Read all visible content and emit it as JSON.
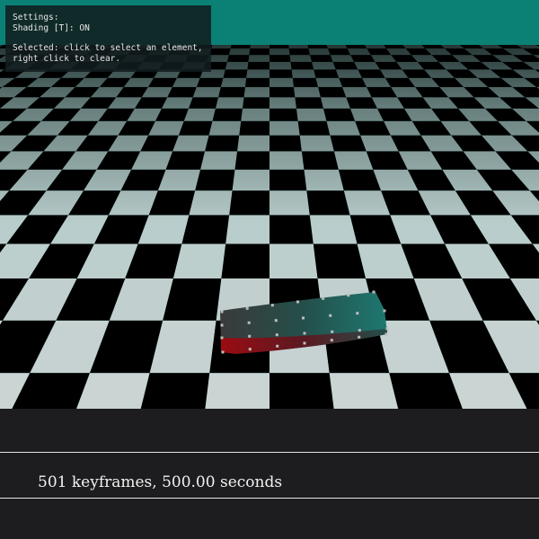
{
  "settings_panel": {
    "title": "Settings:",
    "shading": "Shading [T]: ON",
    "selected_line1": "Selected: click to select an element,",
    "selected_line2": "right click to clear."
  },
  "timeline": {
    "keyframe_info": "501 keyframes, 500.00 seconds"
  },
  "colors": {
    "sky": "#0b8075",
    "floor_light": "#e0e0e0",
    "floor_dark": "#000000",
    "soft_body_teal": "#1a6e66",
    "soft_body_red": "#8b0f14",
    "background": "#1d1d1f"
  }
}
